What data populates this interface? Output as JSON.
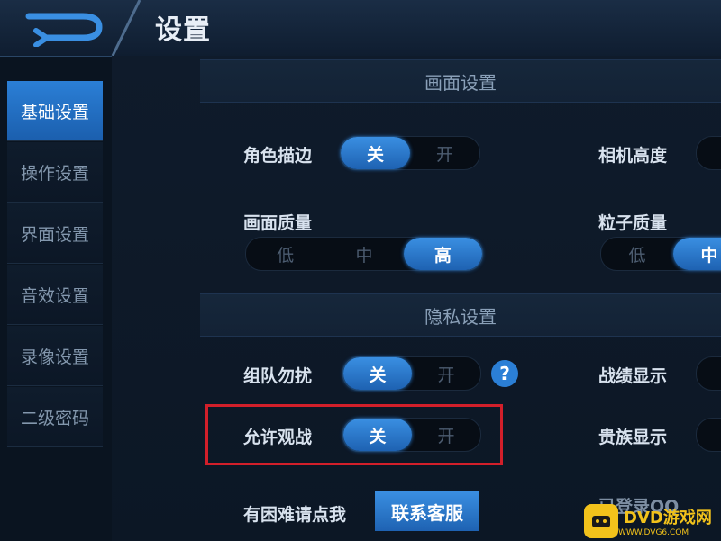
{
  "header": {
    "title": "设置"
  },
  "sidebar": {
    "items": [
      {
        "label": "基础设置",
        "active": true
      },
      {
        "label": "操作设置"
      },
      {
        "label": "界面设置"
      },
      {
        "label": "音效设置"
      },
      {
        "label": "录像设置"
      },
      {
        "label": "二级密码"
      }
    ]
  },
  "sections": {
    "display": "画面设置",
    "privacy": "隐私设置"
  },
  "settings": {
    "outline": {
      "label": "角色描边",
      "off": "关",
      "on": "开",
      "value": "关"
    },
    "camera_height": {
      "label": "相机高度"
    },
    "quality": {
      "label": "画面质量",
      "low": "低",
      "mid": "中",
      "high": "高",
      "value": "高"
    },
    "particle": {
      "label": "粒子质量",
      "low": "低",
      "mid": "中",
      "value": "中"
    },
    "no_disturb": {
      "label": "组队勿扰",
      "off": "关",
      "on": "开",
      "value": "关"
    },
    "stats_display": {
      "label": "战绩显示"
    },
    "allow_watch": {
      "label": "允许观战",
      "off": "关",
      "on": "开",
      "value": "关"
    },
    "noble_display": {
      "label": "贵族显示"
    }
  },
  "support": {
    "text": "有困难请点我",
    "button": "联系客服",
    "partial": "已登录QQ"
  },
  "help_icon": "?",
  "watermark": {
    "text": "DVD游戏网",
    "sub": "WWW.DVG6.COM"
  },
  "colors": {
    "accent": "#2b7fd6",
    "highlight": "#d21f2a"
  }
}
